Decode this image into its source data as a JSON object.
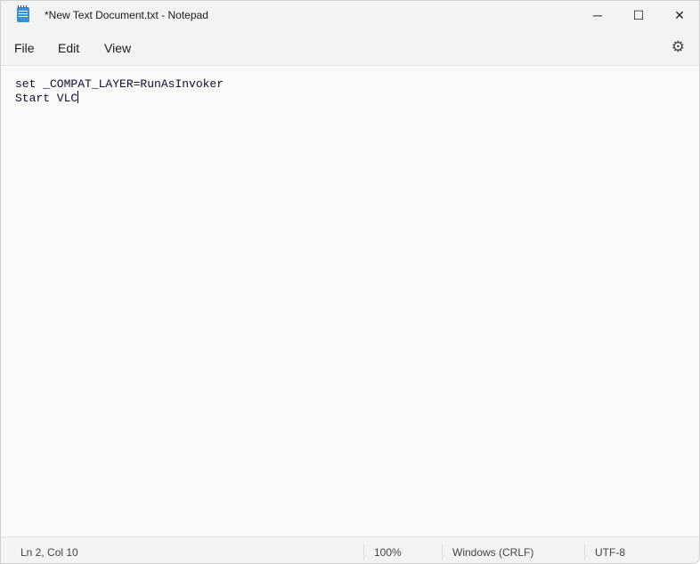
{
  "window": {
    "title": "*New Text Document.txt - Notepad"
  },
  "controls": {
    "minimize": "─",
    "maximize": "☐",
    "close": "✕"
  },
  "menu": {
    "items": [
      "File",
      "Edit",
      "View"
    ],
    "settings_icon": "gear-icon"
  },
  "editor": {
    "lines": [
      "set _COMPAT_LAYER=RunAsInvoker",
      "Start VLC"
    ]
  },
  "status": {
    "position": "Ln 2, Col 10",
    "zoom": "100%",
    "line_ending": "Windows (CRLF)",
    "encoding": "UTF-8"
  }
}
